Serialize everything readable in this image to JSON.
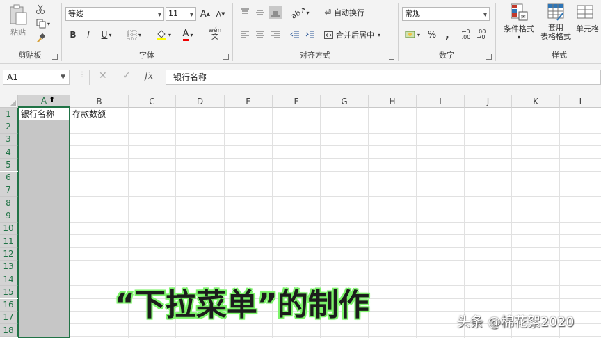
{
  "ribbon": {
    "clipboard": {
      "label": "剪贴板",
      "paste_label": "粘贴"
    },
    "font": {
      "label": "字体",
      "font_name": "等线",
      "font_size": "11",
      "bold": "B",
      "italic": "I",
      "underline": "U",
      "grow": "A",
      "shrink": "A",
      "font_color": "A",
      "phonetic": "wén"
    },
    "alignment": {
      "label": "对齐方式",
      "wrap_text": "自动换行",
      "merge_center": "合并后居中"
    },
    "number": {
      "label": "数字",
      "format": "常规",
      "percent": "%",
      "comma": ","
    },
    "styles": {
      "label": "样式",
      "conditional": "条件格式",
      "table_format_1": "套用",
      "table_format_2": "表格格式",
      "cell_styles": "单元格"
    }
  },
  "formula_bar": {
    "name_box": "A1",
    "fx": "fx",
    "content": "银行名称"
  },
  "grid": {
    "columns": [
      "A",
      "B",
      "C",
      "D",
      "E",
      "F",
      "G",
      "H",
      "I",
      "J",
      "K",
      "L"
    ],
    "rows": [
      "1",
      "2",
      "3",
      "4",
      "5",
      "6",
      "7",
      "8",
      "9",
      "10",
      "11",
      "12",
      "13",
      "14",
      "15",
      "16",
      "17",
      "18"
    ],
    "a1": "银行名称",
    "b1": "存款数额",
    "selected_column": "A"
  },
  "overlay": {
    "title": "“下拉菜单”的制作",
    "watermark": "头条 @棉花絮2020"
  },
  "colors": {
    "accent": "#217346",
    "ribbon_bg": "#f3f3f3",
    "selection": "#c6c6c6",
    "title_glow": "#7cf36a"
  }
}
